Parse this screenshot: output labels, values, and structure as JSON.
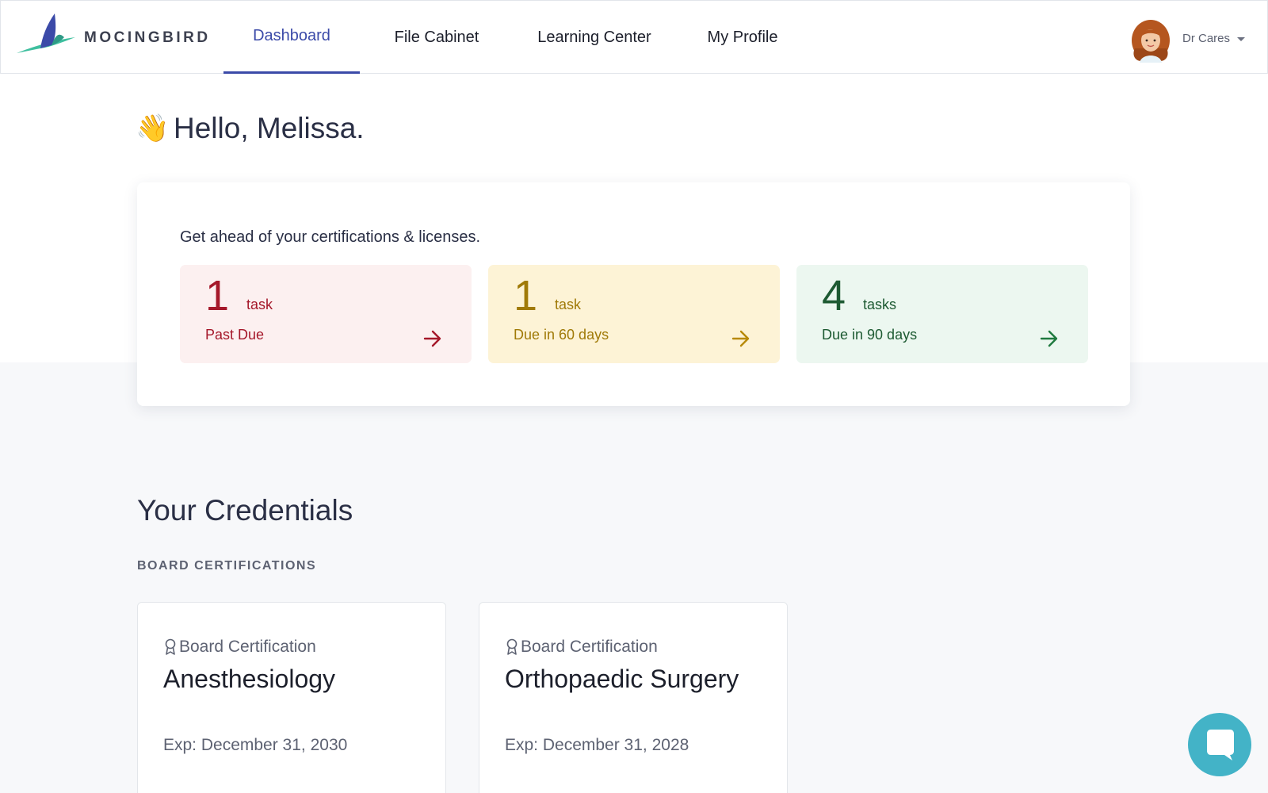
{
  "brand": {
    "name": "MOCINGBIRD"
  },
  "nav": {
    "items": [
      {
        "label": "Dashboard",
        "active": true
      },
      {
        "label": "File Cabinet",
        "active": false
      },
      {
        "label": "Learning Center",
        "active": false
      },
      {
        "label": "My Profile",
        "active": false
      }
    ]
  },
  "user": {
    "name": "Dr Cares",
    "avatar_icon": "avatar-woman-icon"
  },
  "greeting": {
    "emoji": "👋",
    "text": "Hello, Melissa."
  },
  "tasks": {
    "heading": "Get ahead of your certifications & licenses.",
    "tiles": [
      {
        "count": "1",
        "unit": "task",
        "label": "Past Due",
        "color": "#a5182a",
        "bg": "#fcf0f0"
      },
      {
        "count": "1",
        "unit": "task",
        "label": "Due in 60 days",
        "color": "#a07a08",
        "bg": "#fdf3d6"
      },
      {
        "count": "4",
        "unit": "tasks",
        "label": "Due in 90 days",
        "color": "#1d5a32",
        "bg": "#ecf7f0"
      }
    ]
  },
  "credentials": {
    "title": "Your Credentials",
    "section_label": "BOARD CERTIFICATIONS",
    "cards": [
      {
        "type": "Board Certification",
        "name": "Anesthesiology",
        "expiry": "Exp: December 31, 2030"
      },
      {
        "type": "Board Certification",
        "name": "Orthopaedic Surgery",
        "expiry": "Exp: December 31, 2028"
      }
    ]
  },
  "colors": {
    "accent": "#3b4aa8",
    "chat": "#43b3c7"
  }
}
